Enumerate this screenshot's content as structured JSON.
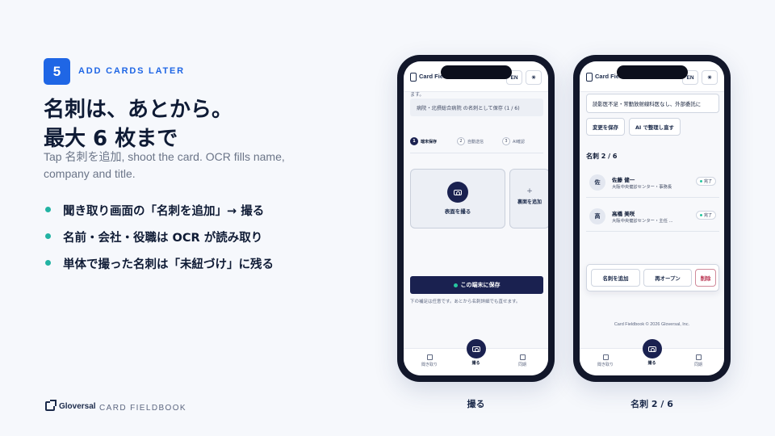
{
  "left": {
    "step_number": "5",
    "step_label": "ADD CARDS LATER",
    "headline_line1": "名刺は、あとから。",
    "headline_line2": "最大 6 枚まで",
    "description": "Tap 名刺を追加, shoot the card. OCR fills name, company and title.",
    "bullets": [
      "聞き取り画面の「名刺を追加」→ 撮る",
      "名前・会社・役職は OCR が読み取り",
      "単体で撮った名刺は「未紐づけ」に残る"
    ],
    "accent_color": "#1f66e5",
    "bullet_color": "#22b3a3"
  },
  "footer": {
    "brand": "Gloversal",
    "product": "CARD FIELDBOOK"
  },
  "phone1": {
    "app_name": "Card Fieldbook",
    "lang_button": "EN",
    "theme_icon": "sun-icon",
    "scrolled_text": "ます。",
    "hint": "病院・北摂総合病院 の名刺として保存 (1 / 6)",
    "steps": [
      {
        "num": "1",
        "label": "端末保存"
      },
      {
        "num": "2",
        "label": "自動送信"
      },
      {
        "num": "3",
        "label": "AI確認"
      }
    ],
    "shoot_front_label": "表面を撮る",
    "add_back_plus": "+",
    "add_back_label": "裏面を追加",
    "save_button": "この端末に保存",
    "save_note": "下の補足は任意です。あとから名刺詳細でも直せます。",
    "nav_left": "聞き取り",
    "nav_center": "撮る",
    "nav_right": "同期",
    "caption": "撮る"
  },
  "phone2": {
    "app_name": "Card Fieldbook",
    "lang_button": "EN",
    "theme_icon": "sun-icon",
    "memo": "読影医不足・常勤放射線科医なし、外部委託に",
    "save_changes": "変更を保存",
    "ai_organize": "AI で整理し直す",
    "count_label": "名刺 2 / 6",
    "cards": [
      {
        "initial": "佐",
        "name": "佐藤 健一",
        "org": "大阪中央健診センター・事務長",
        "status": "完了"
      },
      {
        "initial": "高",
        "name": "高橋 美咲",
        "org": "大阪中央健診センター・主任 ...",
        "status": "完了"
      }
    ],
    "add_card": "名刺を追加",
    "reopen": "再オープン",
    "delete": "削除",
    "copyright": "Card Fieldbook © 2026 Gloversal, Inc.",
    "nav_left": "聞き取り",
    "nav_center": "撮る",
    "nav_right": "同期",
    "caption": "名刺 2 / 6"
  }
}
